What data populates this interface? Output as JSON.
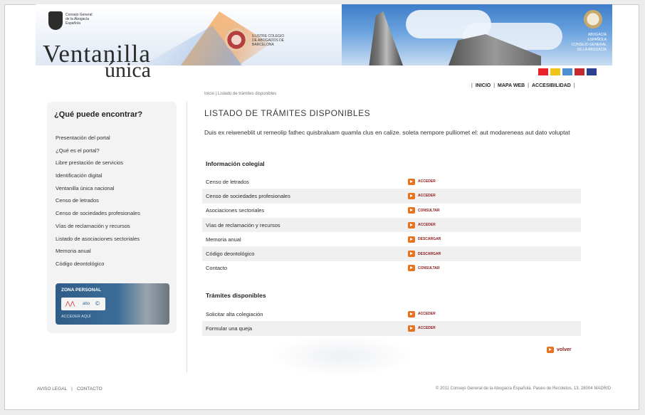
{
  "header": {
    "org_lines": [
      "Consejo General",
      "de la Abogacía",
      "Española"
    ],
    "seal_text": [
      "ILUSTRE COLEGIO",
      "DE ABOGADOS DE",
      "BARCELONA"
    ],
    "right_text": [
      "ABOGACÍA",
      "ESPAÑOLA",
      "CONSEJO GENERAL",
      "DE LA ABOGACÍA"
    ],
    "logo_line1": "Ventanilla",
    "logo_line2": "única",
    "flags": [
      {
        "name": "flag-es",
        "color": "#e6232a"
      },
      {
        "name": "flag-ca",
        "color": "#f0c419"
      },
      {
        "name": "flag-gl",
        "color": "#4f8fd1"
      },
      {
        "name": "flag-eu",
        "color": "#c2282e"
      },
      {
        "name": "flag-en",
        "color": "#2a3f8f"
      }
    ]
  },
  "topnav": {
    "items": [
      "INICIO",
      "MAPA WEB",
      "ACCESIBILIDAD"
    ]
  },
  "breadcrumb": "Inicio | Listado de trámites disponibles",
  "sidebar": {
    "title": "¿Qué puede encontrar?",
    "items": [
      "Presentación del portal",
      "¿Qué es el portal?",
      "Libre prestación de servicios",
      "Identificación digital",
      "Ventanilla única nacional",
      "Censo de letrados",
      "Censo de sociedades profesionales",
      "Vías de reclamación y recursos",
      "Listado de asociaciones sectoriales",
      "Memoria anual",
      "Código deontológico"
    ],
    "banner": {
      "title": "ZONA PERSONAL",
      "brand": "abo",
      "footer": "ACCEDER AQUÍ"
    }
  },
  "main": {
    "title": "LISTADO DE TRÁMITES DISPONIBLES",
    "intro": "Duis ex reiweneblit ut remeolip fathec quisbraluam quamla clus en calize. soleta nempore pulliomet el: aut modareneas aut dato voluptat",
    "info_title": "Información colegial",
    "info_rows": [
      {
        "name": "Censo de letrados",
        "action": "ACCEDER"
      },
      {
        "name": "Censo de sociedades profesionales",
        "action": "ACCEDER"
      },
      {
        "name": "Asociaciones sectoriales",
        "action": "CONSULTAR"
      },
      {
        "name": "Vías de reclamación y recursos",
        "action": "ACCEDER"
      },
      {
        "name": "Memoria anual",
        "action": "DESCARGAR"
      },
      {
        "name": "Código deontológico",
        "action": "DESCARGAR"
      },
      {
        "name": "Contacto",
        "action": "CONSULTAR"
      }
    ],
    "tramites_title": "Trámites disponibles",
    "tramites_rows": [
      {
        "name": "Solicitar alta colegiación",
        "action": "ACCEDER"
      },
      {
        "name": "Formular una queja",
        "action": "ACCEDER"
      }
    ],
    "back_label": "volver"
  },
  "footer": {
    "left": [
      "AVISO LEGAL",
      "|",
      "CONTACTO"
    ],
    "right": "© 2011 Consejo General de la Abogacía Española. Paseo de Recoletos, 13. 28004 MADRID"
  }
}
